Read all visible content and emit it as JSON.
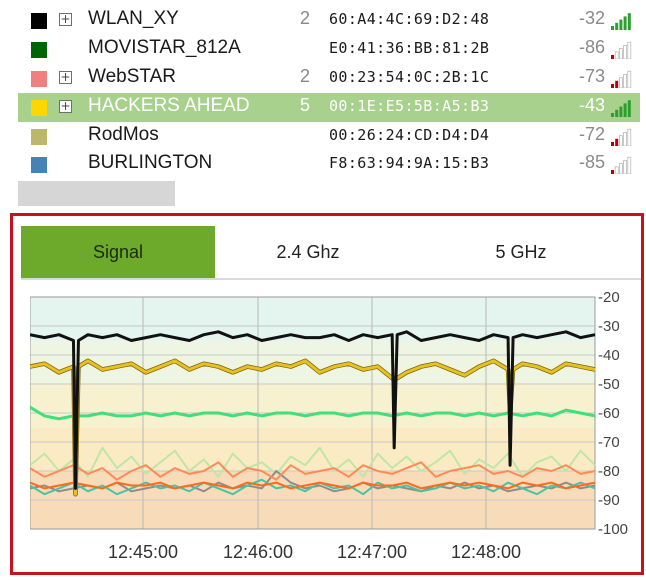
{
  "networks": [
    {
      "ssid": "WLAN_XY",
      "count": "2",
      "mac": "60:A4:4C:69:D2:48",
      "rssi": "-32",
      "color": "#000000",
      "expander": true,
      "selected": false,
      "strength": 5
    },
    {
      "ssid": "MOVISTAR_812A",
      "count": "",
      "mac": "E0:41:36:BB:81:2B",
      "rssi": "-86",
      "color": "#006400",
      "expander": false,
      "selected": false,
      "strength": 1
    },
    {
      "ssid": "WebSTAR",
      "count": "2",
      "mac": "00:23:54:0C:2B:1C",
      "rssi": "-73",
      "color": "#f08080",
      "expander": true,
      "selected": false,
      "strength": 2
    },
    {
      "ssid": "HACKERS AHEAD",
      "count": "5",
      "mac": "00:1E:E5:5B:A5:B3",
      "rssi": "-43",
      "color": "#ffd700",
      "expander": true,
      "selected": true,
      "strength": 5
    },
    {
      "ssid": "RodMos",
      "count": "",
      "mac": "00:26:24:CD:D4:D4",
      "rssi": "-72",
      "color": "#bdb76b",
      "expander": false,
      "selected": false,
      "strength": 2
    },
    {
      "ssid": "BURLINGTON",
      "count": "",
      "mac": "F8:63:94:9A:15:B3",
      "rssi": "-85",
      "color": "#4682b4",
      "expander": false,
      "selected": false,
      "strength": 1
    }
  ],
  "expander_glyph": "+",
  "tabs": [
    {
      "label": "Signal",
      "active": true
    },
    {
      "label": "2.4 Ghz",
      "active": false
    },
    {
      "label": "5 GHz",
      "active": false
    }
  ],
  "colors": {
    "selected_row": "#a8d18d",
    "active_tab": "#6daa2c",
    "panel_border": "#c8101e",
    "bar_on": "#2e9e2e",
    "bar_weak": "#c00000",
    "bar_off": "#c8c8c8"
  },
  "chart_data": {
    "type": "line",
    "y_ticks": [
      "-20",
      "-30",
      "-40",
      "-50",
      "-60",
      "-70",
      "-80",
      "-90",
      "-100"
    ],
    "ylim": [
      -100,
      -20
    ],
    "x_ticks": [
      "12:45:00",
      "12:46:00",
      "12:47:00",
      "12:48:00"
    ],
    "grid": true,
    "bands": [
      {
        "from": -20,
        "to": -35,
        "color": "#e4f4ee"
      },
      {
        "from": -35,
        "to": -50,
        "color": "#eef5e2"
      },
      {
        "from": -50,
        "to": -65,
        "color": "#f7f1cf"
      },
      {
        "from": -65,
        "to": -80,
        "color": "#faebc4"
      },
      {
        "from": -80,
        "to": -100,
        "color": "#f8dcb9"
      }
    ],
    "series": [
      {
        "color": "#111111",
        "width": 3,
        "values": [
          -33,
          -34,
          -33,
          -35,
          -33,
          -34,
          -33,
          -35,
          -34,
          -33,
          -34,
          -35,
          -33,
          -32,
          -34,
          -33,
          -35,
          -34,
          -33,
          -34,
          -34,
          -33,
          -35,
          -33,
          -34,
          -33,
          -32,
          -35,
          -34,
          -33,
          -34,
          -35,
          -33,
          -34,
          -33,
          -34,
          -33,
          -32,
          -34,
          -33
        ],
        "dips": [
          [
            3,
            -86
          ],
          [
            25,
            -72
          ],
          [
            33,
            -78
          ]
        ]
      },
      {
        "color": "#e8c020",
        "width": 3,
        "values": [
          -44,
          -43,
          -46,
          -44,
          -42,
          -45,
          -44,
          -43,
          -46,
          -44,
          -42,
          -45,
          -43,
          -44,
          -46,
          -44,
          -45,
          -43,
          -44,
          -42,
          -46,
          -44,
          -43,
          -45,
          -44,
          -48,
          -46,
          -44,
          -43,
          -45,
          -47,
          -44,
          -42,
          -45,
          -43,
          -44,
          -46,
          -43,
          -44,
          -45
        ],
        "dips": [
          [
            3,
            -88
          ],
          [
            25,
            -48
          ],
          [
            33,
            -60
          ]
        ]
      },
      {
        "color": "#3fe07a",
        "width": 3,
        "values": [
          -58,
          -61,
          -62,
          -61,
          -61,
          -60,
          -61,
          -61,
          -60,
          -61,
          -60,
          -61,
          -60,
          -60,
          -61,
          -60,
          -61,
          -60,
          -60,
          -61,
          -60,
          -60,
          -61,
          -60,
          -60,
          -61,
          -60,
          -61,
          -60,
          -60,
          -61,
          -60,
          -61,
          -60,
          -61,
          -60,
          -61,
          -59,
          -60,
          -61
        ],
        "dips": []
      },
      {
        "color": "#ff8a55",
        "width": 2,
        "values": [
          -79,
          -82,
          -80,
          -78,
          -81,
          -79,
          -83,
          -80,
          -78,
          -82,
          -79,
          -81,
          -80,
          -77,
          -82,
          -79,
          -80,
          -83,
          -78,
          -81,
          -80,
          -79,
          -82,
          -78,
          -80,
          -81,
          -79,
          -77,
          -82,
          -80,
          -79,
          -78,
          -81,
          -80,
          -82,
          -79,
          -80,
          -78,
          -81,
          -80
        ],
        "dips": []
      },
      {
        "color": "#ff6a1a",
        "width": 2,
        "values": [
          -84,
          -86,
          -85,
          -84,
          -85,
          -86,
          -84,
          -85,
          -85,
          -84,
          -86,
          -85,
          -84,
          -85,
          -86,
          -84,
          -85,
          -84,
          -86,
          -85,
          -84,
          -85,
          -86,
          -84,
          -85,
          -85,
          -84,
          -86,
          -85,
          -84,
          -85,
          -84,
          -85,
          -86,
          -84,
          -85,
          -84,
          -86,
          -85,
          -84
        ],
        "dips": []
      },
      {
        "color": "#48c4a4",
        "width": 2,
        "values": [
          -85,
          -88,
          -86,
          -84,
          -87,
          -85,
          -88,
          -86,
          -84,
          -86,
          -85,
          -87,
          -84,
          -86,
          -88,
          -85,
          -83,
          -86,
          -85,
          -87,
          -84,
          -86,
          -85,
          -88,
          -84,
          -86,
          -85,
          -87,
          -86,
          -84,
          -86,
          -85,
          -87,
          -84,
          -86,
          -88,
          -85,
          -86,
          -84,
          -86
        ],
        "dips": []
      },
      {
        "color": "#8d8d8d",
        "width": 2,
        "values": [
          -86,
          -85,
          -87,
          -86,
          -85,
          -86,
          -84,
          -87,
          -86,
          -85,
          -86,
          -85,
          -87,
          -84,
          -86,
          -85,
          -86,
          -80,
          -84,
          -86,
          -85,
          -87,
          -86,
          -84,
          -86,
          -85,
          -86,
          -87,
          -85,
          -86,
          -84,
          -86,
          -85,
          -87,
          -86,
          -85,
          -86,
          -84,
          -86,
          -85
        ],
        "dips": []
      },
      {
        "color": "#bfe6a8",
        "width": 2,
        "values": [
          -78,
          -74,
          -80,
          -76,
          -82,
          -72,
          -79,
          -75,
          -81,
          -77,
          -73,
          -80,
          -76,
          -82,
          -74,
          -79,
          -77,
          -81,
          -75,
          -78,
          -72,
          -80,
          -76,
          -82,
          -74,
          -79,
          -75,
          -80,
          -77,
          -73,
          -81,
          -76,
          -79,
          -74,
          -82,
          -77,
          -75,
          -80,
          -73,
          -78
        ],
        "dips": []
      }
    ]
  }
}
